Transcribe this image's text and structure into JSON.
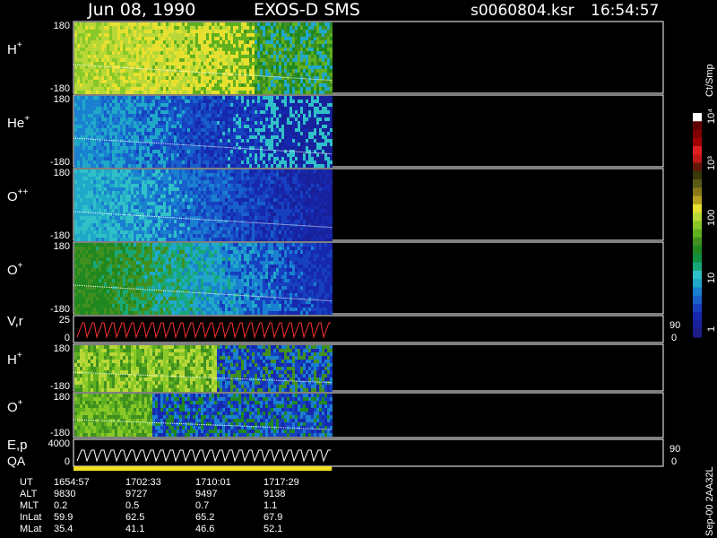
{
  "header": {
    "date": "Jun 08, 1990",
    "mission": "EXOS-D SMS",
    "file": "s0060804.ksr",
    "time": "16:54:57"
  },
  "colorbar": {
    "unit_label": "Ct/Smp",
    "tick_labels": [
      "1",
      "10",
      "100",
      "10³",
      "10⁴"
    ],
    "colors": [
      "#1c1e86",
      "#18209a",
      "#1628ad",
      "#1640c0",
      "#1860cc",
      "#1a80d0",
      "#20a8c8",
      "#30c0c8",
      "#18a878",
      "#109040",
      "#208820",
      "#409020",
      "#60b020",
      "#88c828",
      "#b8d838",
      "#e8e030",
      "#b8a020",
      "#887818",
      "#5a5a18",
      "#383808",
      "#601808",
      "#c01818",
      "#e02020",
      "#a00000",
      "#800000",
      "#600000",
      "#ffffff"
    ]
  },
  "chart_data": {
    "type": "heatmap",
    "panels": [
      {
        "id": "H+ (1)",
        "label": "H",
        "sup": "+",
        "ylim": [
          -180,
          180
        ],
        "y_ticks": [
          "180",
          "-180"
        ],
        "profile": "hplus"
      },
      {
        "id": "He+",
        "label": "He",
        "sup": "+",
        "ylim": [
          -180,
          180
        ],
        "y_ticks": [
          "180",
          "-180"
        ],
        "profile": "heplus"
      },
      {
        "id": "O++",
        "label": "O",
        "sup": "++",
        "ylim": [
          -180,
          180
        ],
        "y_ticks": [
          "180",
          "-180"
        ],
        "profile": "oplusplus"
      },
      {
        "id": "O+ (1)",
        "label": "O",
        "sup": "+",
        "ylim": [
          -180,
          180
        ],
        "y_ticks": [
          "180",
          "-180"
        ],
        "profile": "oplus"
      },
      {
        "id": "V,r",
        "label": "V,r",
        "sup": "",
        "ylim": [
          0,
          25
        ],
        "y_ticks": [
          "25",
          "0"
        ],
        "right_ticks": [
          "90",
          "0"
        ],
        "profile": "line"
      },
      {
        "id": "H+ (2)",
        "label": "H",
        "sup": "+",
        "ylim": [
          -180,
          180
        ],
        "y_ticks": [
          "180",
          "-180"
        ],
        "profile": "hplus2"
      },
      {
        "id": "O+ (2)",
        "label": "O",
        "sup": "+",
        "ylim": [
          -180,
          180
        ],
        "y_ticks": [
          "180",
          "-180"
        ],
        "profile": "oplus2"
      },
      {
        "id": "E,p QA",
        "label": "E,p",
        "label2": "QA",
        "sup": "",
        "ylim": [
          0,
          4000
        ],
        "y_ticks": [
          "4000",
          "0"
        ],
        "right_ticks": [
          "90",
          "0"
        ],
        "profile": "ep"
      }
    ],
    "ut_ticks": [
      "1654:57",
      "1702:33",
      "1710:01",
      "1717:29"
    ],
    "data_fraction_of_axis": 0.438
  },
  "footer": {
    "rows": [
      {
        "label": "UT",
        "values": [
          "1654:57",
          "1702:33",
          "1710:01",
          "1717:29"
        ]
      },
      {
        "label": "ALT",
        "values": [
          "9830",
          "9727",
          "9497",
          "9138"
        ]
      },
      {
        "label": "MLT",
        "values": [
          "0.2",
          "0.5",
          "0.7",
          "1.1"
        ]
      },
      {
        "label": "InLat",
        "values": [
          "59.9",
          "62.5",
          "65.2",
          "67.9"
        ]
      },
      {
        "label": "MLat",
        "values": [
          "35.4",
          "41.1",
          "46.6",
          "52.1"
        ]
      }
    ],
    "vertical_note": "Sep-00 2AA32L"
  }
}
